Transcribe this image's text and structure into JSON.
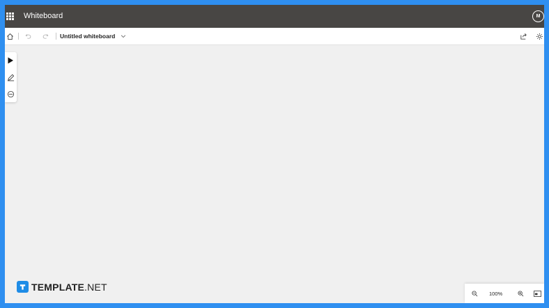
{
  "app": {
    "title": "Whiteboard",
    "user_initial": "M"
  },
  "toolbar": {
    "document_title": "Untitled whiteboard"
  },
  "tools": [
    {
      "icon": "pointer-icon"
    },
    {
      "icon": "pen-icon"
    },
    {
      "icon": "eraser-icon"
    }
  ],
  "zoom": {
    "level": "100%"
  },
  "watermark": {
    "brand": "TEMPLATE",
    "suffix": ".NET"
  },
  "colors": {
    "titlebar": "#484644",
    "canvas": "#f0f0f0",
    "border": "#2f8ff0",
    "logo_accent": "#1e8ce6"
  }
}
